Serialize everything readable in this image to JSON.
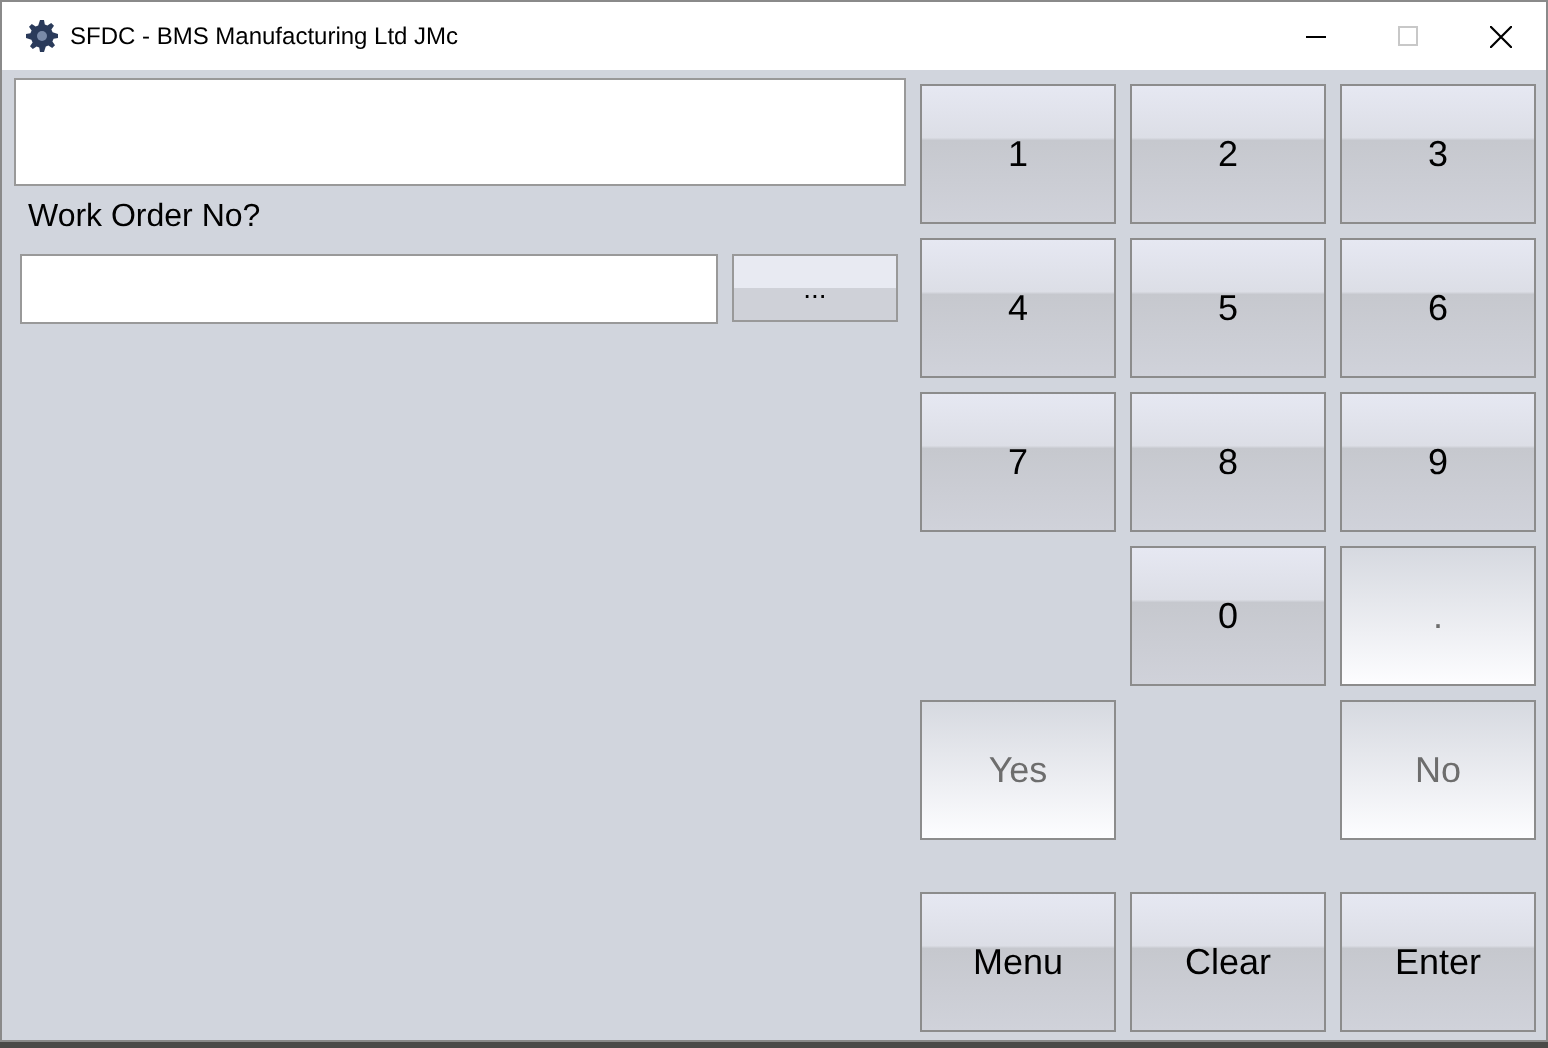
{
  "window": {
    "title": "SFDC - BMS Manufacturing Ltd JMc",
    "maximize_disabled": true
  },
  "prompt": "Work Order No?",
  "browse_button": "...",
  "keypad": [
    {
      "keys": [
        {
          "kind": "key",
          "label": "1",
          "disabled": false
        },
        {
          "kind": "key",
          "label": "2",
          "disabled": false
        },
        {
          "kind": "key",
          "label": "3",
          "disabled": false
        }
      ]
    },
    {
      "keys": [
        {
          "kind": "key",
          "label": "4",
          "disabled": false
        },
        {
          "kind": "key",
          "label": "5",
          "disabled": false
        },
        {
          "kind": "key",
          "label": "6",
          "disabled": false
        }
      ]
    },
    {
      "keys": [
        {
          "kind": "key",
          "label": "7",
          "disabled": false
        },
        {
          "kind": "key",
          "label": "8",
          "disabled": false
        },
        {
          "kind": "key",
          "label": "9",
          "disabled": false
        }
      ]
    },
    {
      "keys": [
        {
          "kind": "spacer"
        },
        {
          "kind": "key",
          "label": "0",
          "disabled": false
        },
        {
          "kind": "key",
          "label": ".",
          "disabled": true
        }
      ]
    },
    {
      "keys": [
        {
          "kind": "key",
          "label": "Yes",
          "disabled": true
        },
        {
          "kind": "spacer"
        },
        {
          "kind": "key",
          "label": "No",
          "disabled": true
        }
      ]
    },
    {
      "keys": [
        {
          "kind": "key",
          "label": "Menu",
          "disabled": false
        },
        {
          "kind": "key",
          "label": "Clear",
          "disabled": false
        },
        {
          "kind": "key",
          "label": "Enter",
          "disabled": false
        }
      ]
    }
  ]
}
